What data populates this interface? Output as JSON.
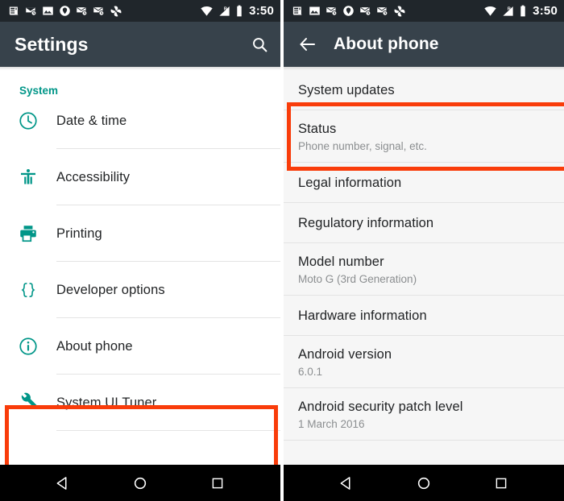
{
  "left_screen": {
    "statusbar": {
      "icons": [
        "news-icon",
        "mail-clock-icon",
        "photo-icon",
        "shield-icon",
        "mail-clock-icon",
        "mail-clock-icon",
        "pinwheel-icon"
      ],
      "wifi_icon": "wifi-icon",
      "signal_icon": "signal-roaming-icon",
      "battery_icon": "battery-icon",
      "time": "3:50"
    },
    "appbar": {
      "title": "Settings",
      "search_icon": "search-icon"
    },
    "section_header": "System",
    "items": [
      {
        "label": "Date & time",
        "icon": "clock-icon"
      },
      {
        "label": "Accessibility",
        "icon": "accessibility-icon"
      },
      {
        "label": "Printing",
        "icon": "printer-icon"
      },
      {
        "label": "Developer options",
        "icon": "braces-icon"
      },
      {
        "label": "About phone",
        "icon": "info-icon"
      },
      {
        "label": "System UI Tuner",
        "icon": "wrench-icon"
      }
    ],
    "highlighted_item": "About phone"
  },
  "right_screen": {
    "statusbar": {
      "icons": [
        "news-icon",
        "photo-icon",
        "mail-clock-icon",
        "shield-icon",
        "mail-clock-icon",
        "mail-clock-icon",
        "pinwheel-icon"
      ],
      "wifi_icon": "wifi-icon",
      "signal_icon": "signal-roaming-icon",
      "battery_icon": "battery-icon",
      "time": "3:50"
    },
    "appbar": {
      "back_icon": "back-arrow-icon",
      "title": "About phone"
    },
    "items": [
      {
        "title": "System updates",
        "sub": ""
      },
      {
        "title": "Status",
        "sub": "Phone number, signal, etc."
      },
      {
        "title": "Legal information",
        "sub": ""
      },
      {
        "title": "Regulatory information",
        "sub": ""
      },
      {
        "title": "Model number",
        "sub": "Moto G (3rd Generation)"
      },
      {
        "title": "Hardware information",
        "sub": ""
      },
      {
        "title": "Android version",
        "sub": "6.0.1"
      },
      {
        "title": "Android security patch level",
        "sub": "1 March 2016"
      }
    ],
    "highlighted_item": "Status"
  },
  "navbar": {
    "back_label": "back-nav",
    "home_label": "home-nav",
    "recents_label": "recents-nav"
  },
  "colors": {
    "accent_teal": "#009688",
    "appbar": "#37424b",
    "statusbar": "#20262b",
    "highlight_red": "#f93c0a"
  }
}
